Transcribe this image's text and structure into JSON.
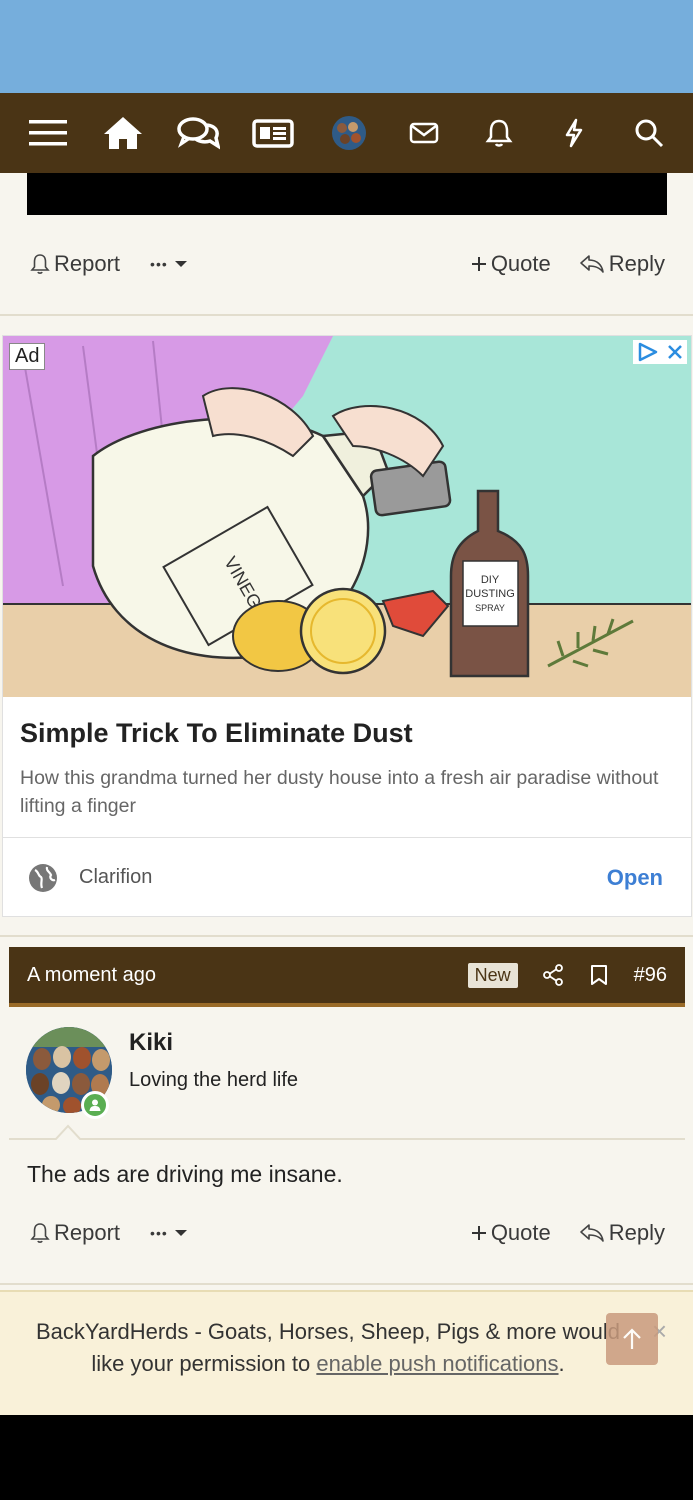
{
  "navbar": {
    "icons": [
      "menu-icon",
      "home-icon",
      "forums-icon",
      "news-icon",
      "user-avatar",
      "inbox-icon",
      "alerts-icon",
      "whats-new-icon",
      "search-icon"
    ]
  },
  "post_actions_top": {
    "report": "Report",
    "more": "•••",
    "quote": "Quote",
    "reply": "Reply"
  },
  "ad": {
    "badge": "Ad",
    "image_label_jug": "VINEGAR",
    "image_label_bottle": [
      "DIY",
      "DUSTING",
      "SPRAY"
    ],
    "title": "Simple Trick To Eliminate Dust",
    "description": "How this grandma turned her dusty house into a fresh air paradise without lifting a finger",
    "advertiser": "Clarifion",
    "cta": "Open"
  },
  "post": {
    "time": "A moment ago",
    "badge": "New",
    "number": "#96",
    "username": "Kiki",
    "user_title": "Loving the herd life",
    "body": "The ads are driving me insane.",
    "actions": {
      "report": "Report",
      "more": "•••",
      "quote": "Quote",
      "reply": "Reply"
    }
  },
  "push_notice": {
    "text_before": "BackYardHerds - Goats, Horses, Sheep, Pigs & more would like your permission to ",
    "link": "enable push notifications",
    "text_after": ".",
    "close": "×"
  },
  "colors": {
    "navbar": "#4a3415",
    "status_bar": "#76aedc",
    "page_bg": "#f7f5ee",
    "accent_link": "#3d7fd4",
    "online": "#5aae52"
  }
}
